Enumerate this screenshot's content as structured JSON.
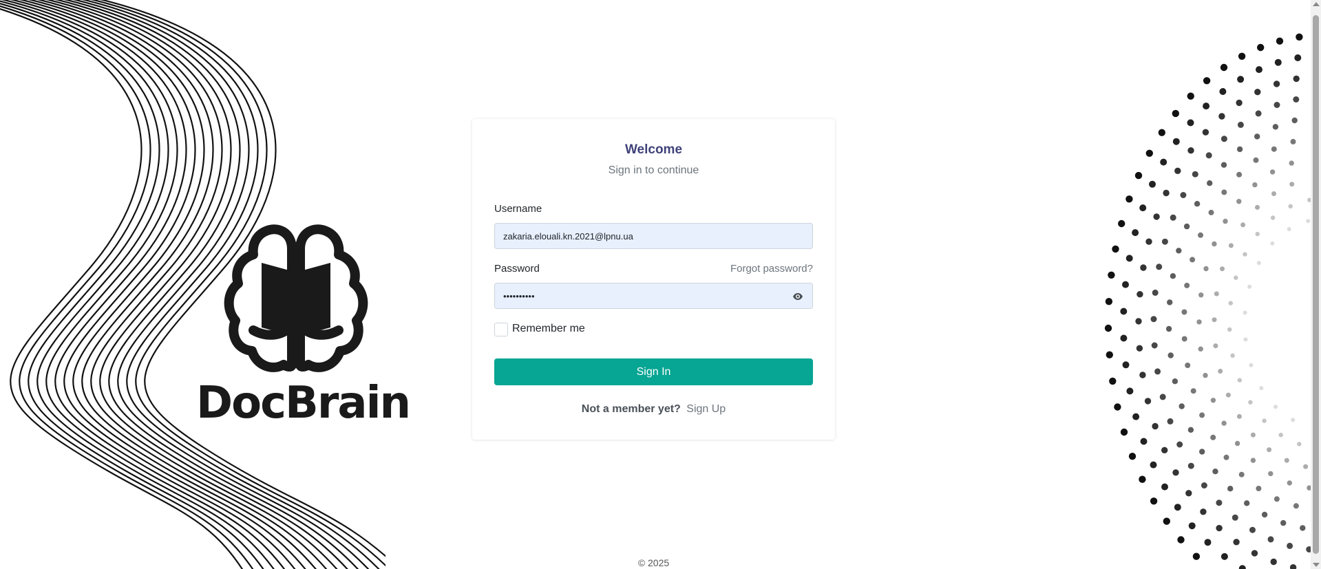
{
  "brand": {
    "name": "DocBrain"
  },
  "login": {
    "title": "Welcome",
    "subtitle": "Sign in to continue",
    "username_label": "Username",
    "username_value": "zakaria.elouali.kn.2021@lpnu.ua",
    "password_label": "Password",
    "password_value": "••••••••••",
    "forgot_label": "Forgot password?",
    "remember_label": "Remember me",
    "remember_checked": false,
    "signin_label": "Sign In",
    "signup_question": "Not a member yet?",
    "signup_link": "Sign Up"
  },
  "footer": {
    "copyright": "© 2025"
  },
  "colors": {
    "primary": "#07a593",
    "title": "#3f4279",
    "input_bg": "#e8f0fe"
  },
  "icons": {
    "password_toggle": "eye-icon"
  }
}
